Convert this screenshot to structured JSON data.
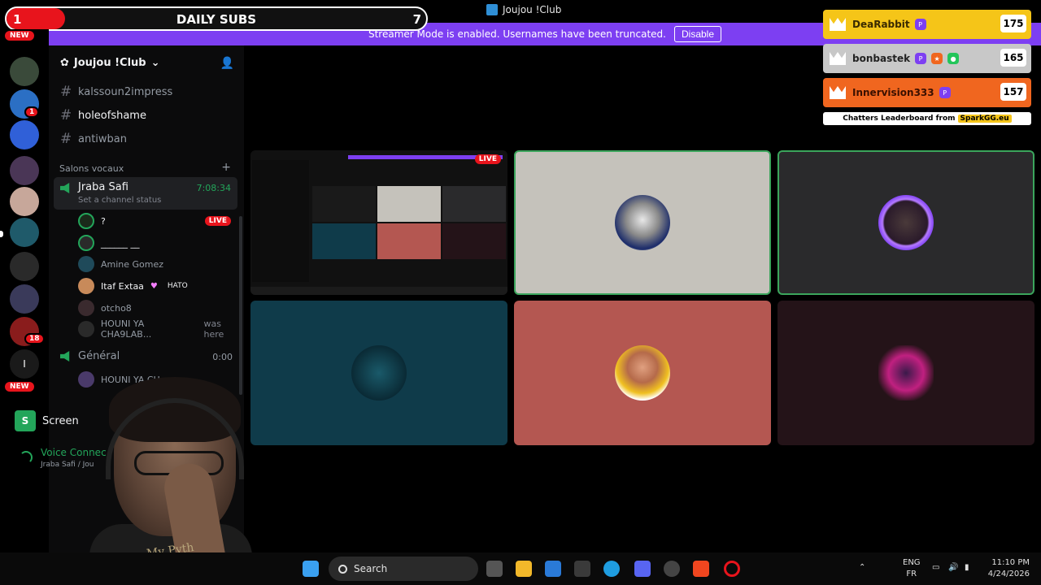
{
  "window": {
    "title": "Joujou !Club"
  },
  "banner": {
    "text": "Streamer Mode is enabled. Usernames have been truncated.",
    "button": "Disable"
  },
  "daily_subs": {
    "count": "1",
    "label": "DAILY SUBS",
    "goal": "7",
    "progress": 0.14
  },
  "rail": {
    "new_top": "NEW",
    "new_bottom": "NEW",
    "badge_1": "1",
    "badge_18": "18",
    "letter": "I"
  },
  "server": {
    "name": "Joujou !Club"
  },
  "text_channels": [
    {
      "name": "kalssoun2impress"
    },
    {
      "name": "holeofshame"
    },
    {
      "name": "antiwban"
    }
  ],
  "voice_category": {
    "label": "Salons vocaux"
  },
  "voice_channel": {
    "name": "Jraba Safi",
    "status": "Set a channel status",
    "timer": "7:08:34"
  },
  "members": [
    {
      "name": "?",
      "live": "LIVE"
    },
    {
      "name": "______ __"
    },
    {
      "name": "Amine Gomez"
    },
    {
      "name": "Itaf Extaa",
      "tag": "HATO"
    },
    {
      "name": "otcho8"
    },
    {
      "name": "HOUNI YA CHA9LAB...",
      "suffix": "was here"
    }
  ],
  "general_channel": {
    "name": "Général",
    "timer": "0:00",
    "member": "HOUNI YA CH"
  },
  "bottom_panel": {
    "screen_label": "Screen",
    "voice_connected": "Voice Connec",
    "voice_sub": "Jraba Safi / Jou"
  },
  "stage": {
    "live_label": "LIVE"
  },
  "webcam": {
    "shirt_text": "My Pyth"
  },
  "leaderboard": {
    "rows": [
      {
        "name": "DeaRabbit",
        "score": "175",
        "color": "#f5c518"
      },
      {
        "name": "bonbastek",
        "score": "165",
        "color": "#c8c8c8"
      },
      {
        "name": "Innervision333",
        "score": "157",
        "color": "#f0661f"
      }
    ],
    "footer_prefix": "Chatters Leaderboard from",
    "footer_brand": "SparkGG.eu"
  },
  "taskbar": {
    "search_placeholder": "Search",
    "lang_top": "ENG",
    "lang_bottom": "FR",
    "time": "11:10 PM",
    "date": "4/24/2026"
  },
  "colors": {
    "accent": "#7d3ff2",
    "live": "#e8141c",
    "voice_green": "#23a55a"
  }
}
